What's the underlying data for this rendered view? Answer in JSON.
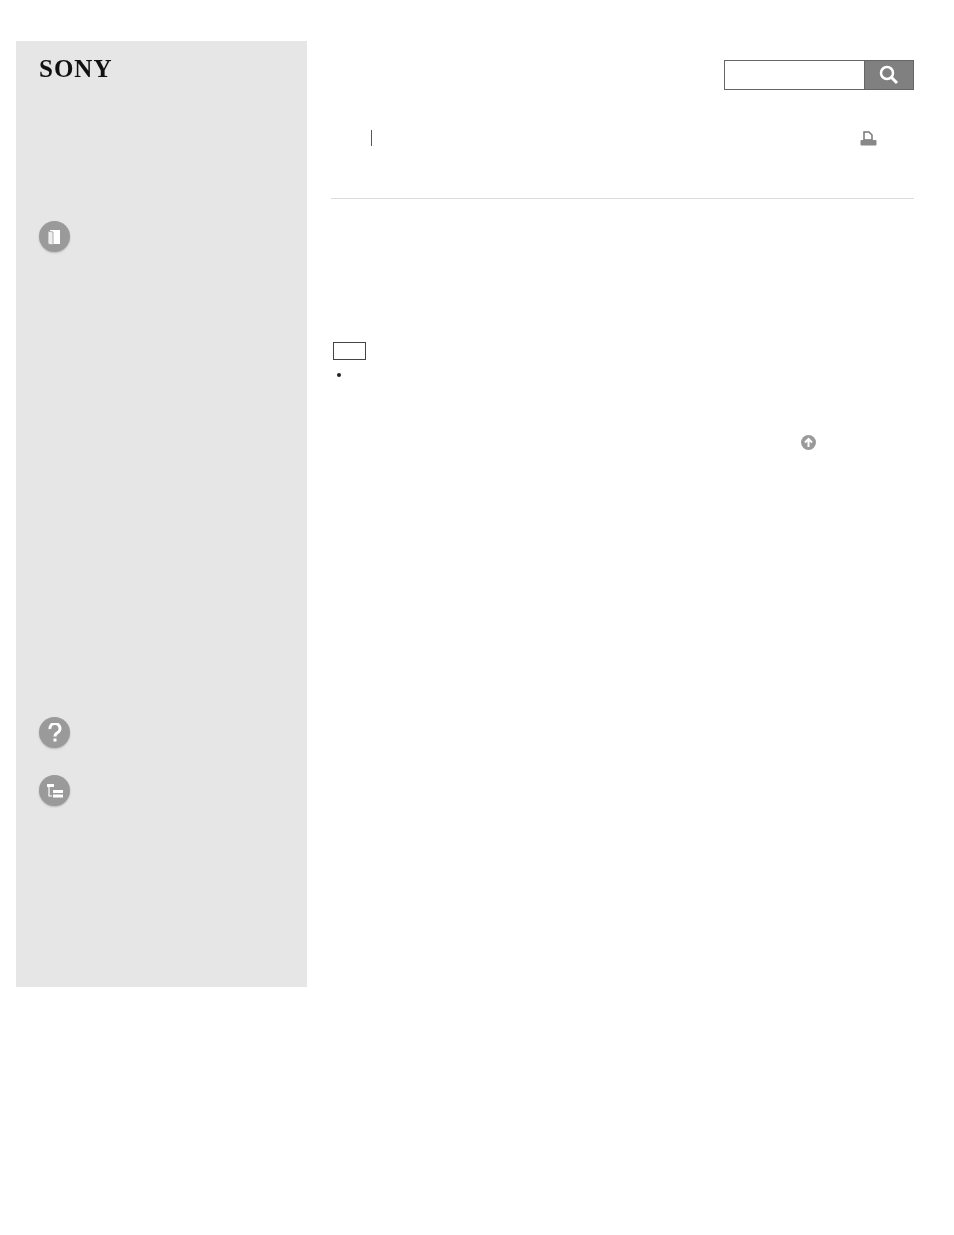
{
  "brand": "SONY"
}
